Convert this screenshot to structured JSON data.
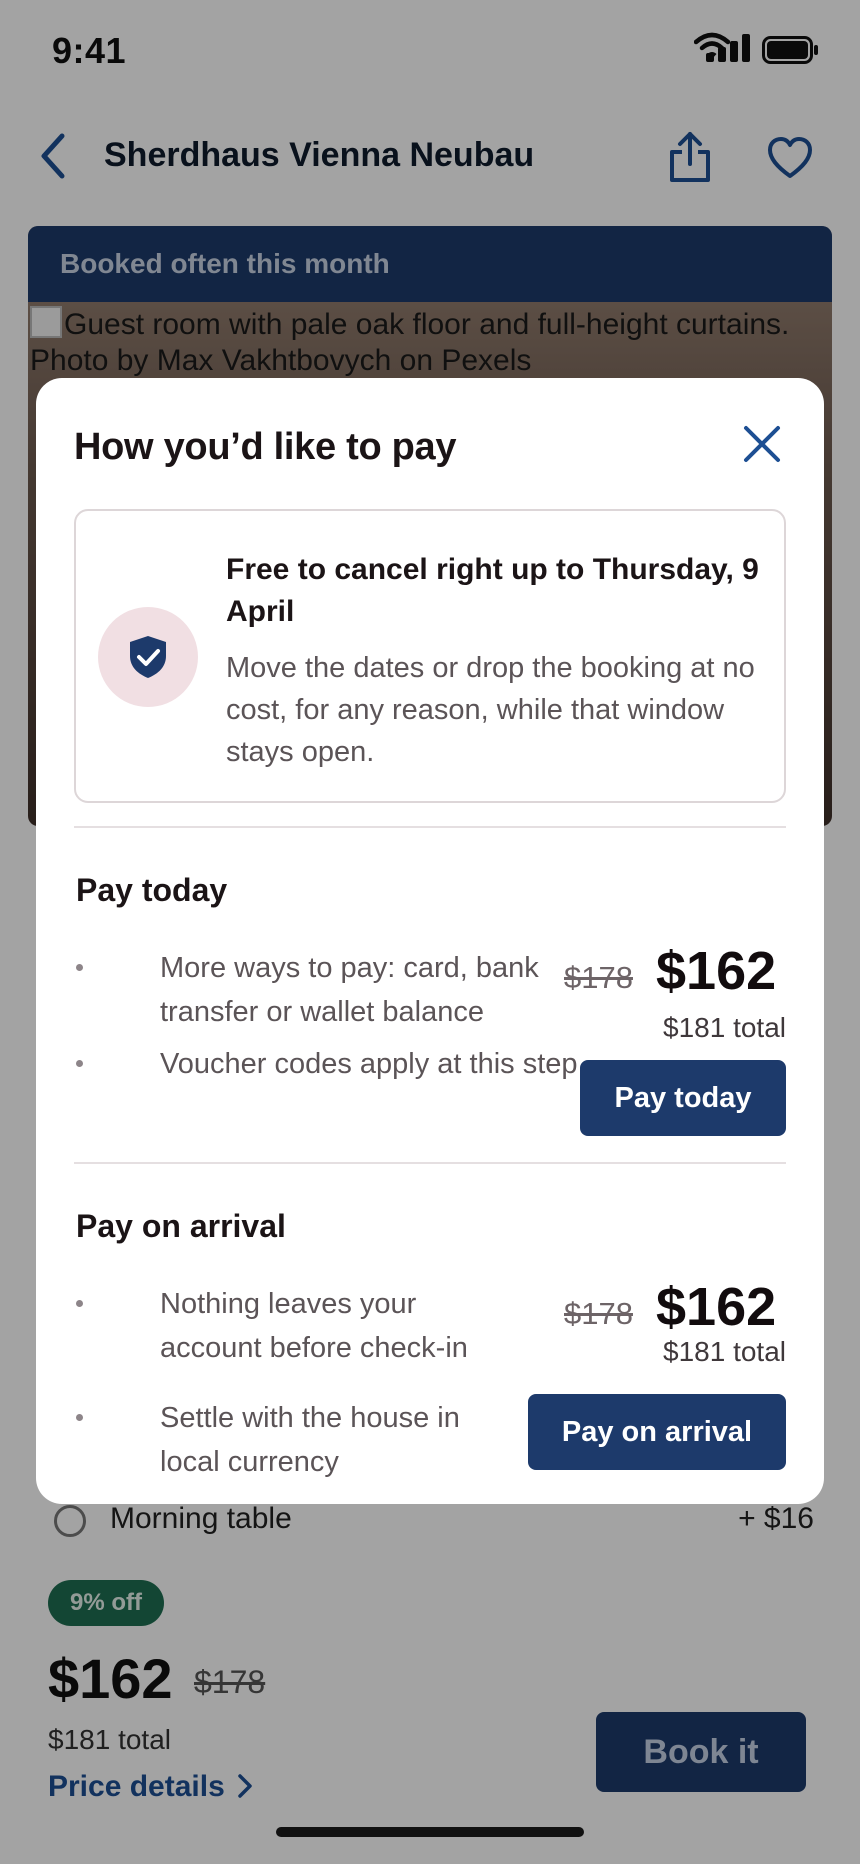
{
  "status": {
    "time": "9:41"
  },
  "nav": {
    "title": "Sherdhaus Vienna Neubau"
  },
  "hero": {
    "banner": "Booked often this month",
    "image_alt": "Guest room with pale oak floor and full-height curtains. Photo by Max Vakhtbovych on Pexels"
  },
  "addon": {
    "label": "Morning table",
    "price": "+ $16"
  },
  "bottom": {
    "badge": "9% off",
    "price": "$162",
    "old_price": "$178",
    "total": "$181 total",
    "details_label": "Price details",
    "book_label": "Book it"
  },
  "modal": {
    "title": "How you’d like to pay",
    "notice": {
      "heading": "Free to cancel right up to Thursday, 9 April",
      "body": "Move the dates or drop the booking at no cost, for any reason, while that window stays open."
    },
    "pay_today": {
      "title": "Pay today",
      "bullets": [
        "More ways to pay: card, bank transfer or wallet balance",
        "Voucher codes apply at this step"
      ],
      "old_price": "$178",
      "price": "$162",
      "total": "$181 total",
      "button": "Pay today"
    },
    "pay_arrival": {
      "title": "Pay on arrival",
      "bullets": [
        "Nothing leaves your account before check-in",
        "Settle with the house in local currency"
      ],
      "old_price": "$178",
      "price": "$162",
      "total": "$181 total",
      "button": "Pay on arrival"
    }
  },
  "colors": {
    "accent": "#1d3a6b",
    "badge": "#1f6e52",
    "link": "#1d4f93"
  }
}
